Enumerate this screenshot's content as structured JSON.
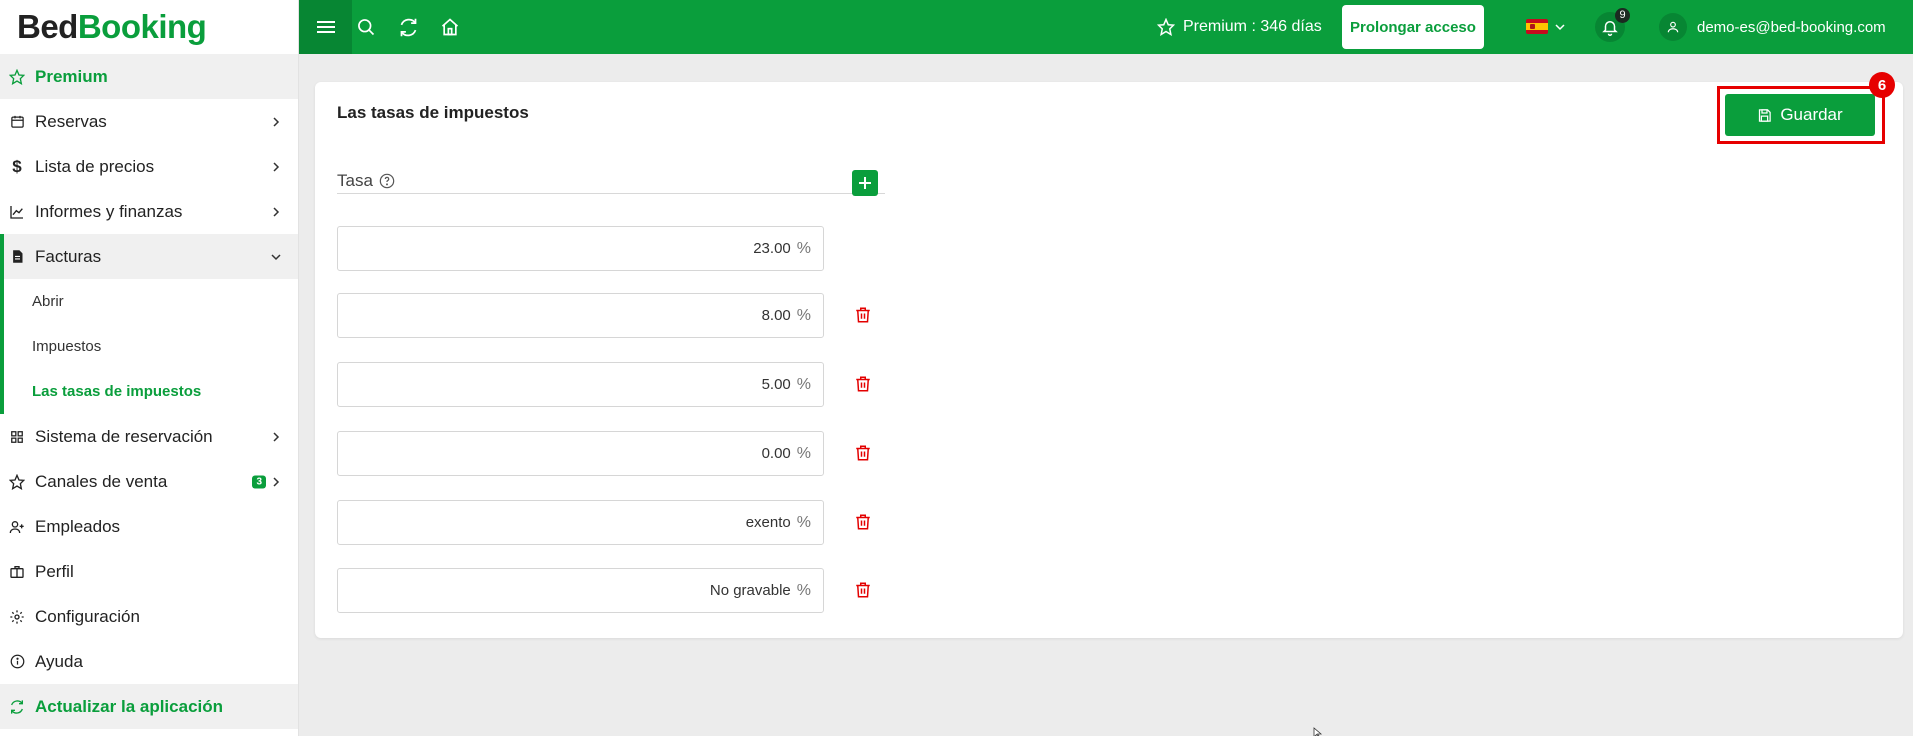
{
  "sidebar": {
    "logo": {
      "part1": "Bed",
      "part2": "Booking"
    },
    "items": [
      {
        "label": "Premium",
        "icon": "star-icon"
      },
      {
        "label": "Reservas",
        "icon": "calendar-icon"
      },
      {
        "label": "Lista de precios",
        "icon": "dollar-icon"
      },
      {
        "label": "Informes y finanzas",
        "icon": "chart-line-icon"
      },
      {
        "label": "Facturas",
        "icon": "invoice-icon"
      },
      {
        "label": "Sistema de reservación",
        "icon": "grid-icon"
      },
      {
        "label": "Canales de venta",
        "icon": "star-outline-icon",
        "badge": "3"
      },
      {
        "label": "Empleados",
        "icon": "user-plus-icon"
      },
      {
        "label": "Perfil",
        "icon": "briefcase-icon"
      },
      {
        "label": "Configuración",
        "icon": "gear-icon"
      },
      {
        "label": "Ayuda",
        "icon": "info-icon"
      },
      {
        "label": "Actualizar la aplicación",
        "icon": "refresh-icon"
      }
    ],
    "subitems": [
      {
        "label": "Abrir"
      },
      {
        "label": "Impuestos"
      },
      {
        "label": "Las tasas de impuestos"
      }
    ]
  },
  "header": {
    "premium_text": "Premium : 346 días",
    "prolong_label": "Prolongar acceso",
    "notification_count": "9",
    "user_email": "demo-es@bed-booking.com"
  },
  "main": {
    "title": "Las tasas de impuestos",
    "save_label": "Guardar",
    "step_badge": "6",
    "tasa_label": "Tasa",
    "percent_symbol": "%",
    "rates": [
      "23.00",
      "8.00",
      "5.00",
      "0.00",
      "exento",
      "No gravable"
    ]
  },
  "colors": {
    "brand": "#0a9e3c",
    "highlight": "#e60000"
  }
}
